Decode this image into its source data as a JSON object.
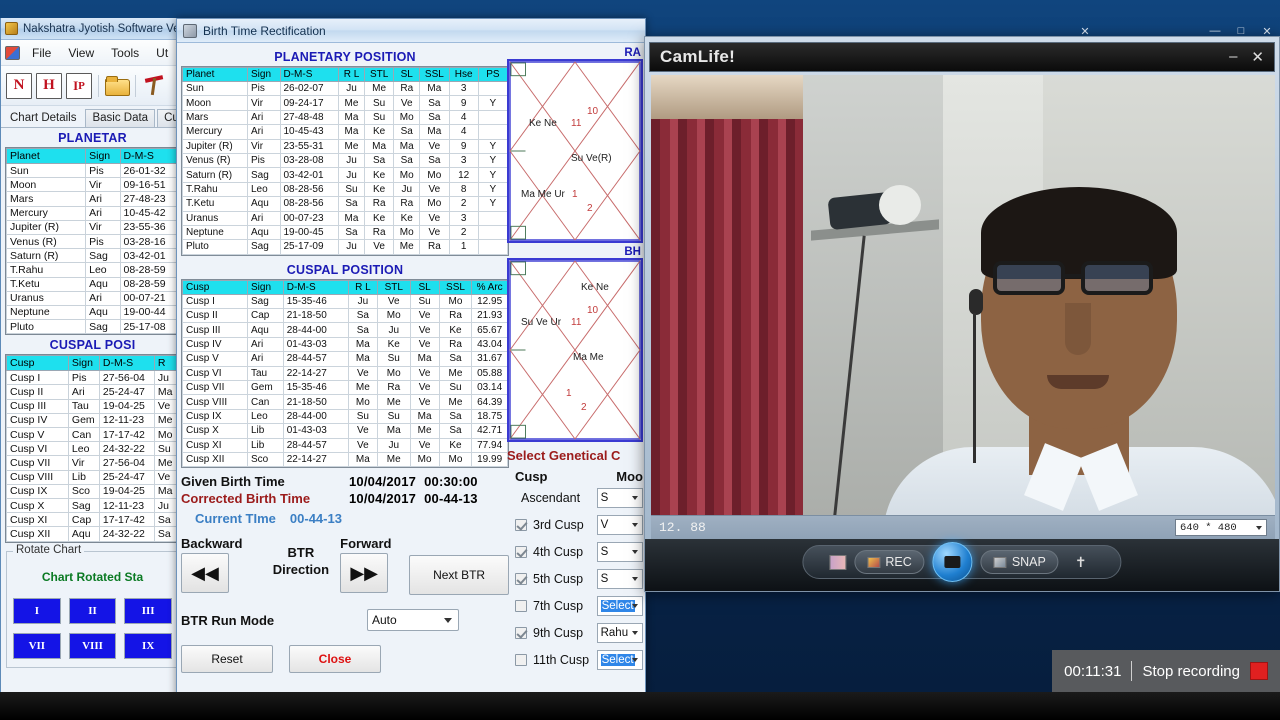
{
  "main_window": {
    "title": "Nakshatra Jyotish Software Ve",
    "menu": [
      "File",
      "View",
      "Tools",
      "Ut"
    ],
    "toolbar_icons": [
      "n-icon",
      "h-icon",
      "lp-icon",
      "open-folder-icon",
      "pin-icon"
    ],
    "tabs": [
      {
        "label": "Chart Details",
        "active": true
      },
      {
        "label": "Basic Data",
        "active": false
      },
      {
        "label": "Cuspal",
        "active": false
      }
    ],
    "planetary_title": "PLANETAR",
    "planetary_headers": [
      "Planet",
      "Sign",
      "D-M-S"
    ],
    "planetary_rows": [
      [
        "Sun",
        "Pis",
        "26-01-32"
      ],
      [
        "Moon",
        "Vir",
        "09-16-51"
      ],
      [
        "Mars",
        "Ari",
        "27-48-23"
      ],
      [
        "Mercury",
        "Ari",
        "10-45-42"
      ],
      [
        "Jupiter (R)",
        "Vir",
        "23-55-36"
      ],
      [
        "Venus (R)",
        "Pis",
        "03-28-16"
      ],
      [
        "Saturn (R)",
        "Sag",
        "03-42-01"
      ],
      [
        "T.Rahu",
        "Leo",
        "08-28-59"
      ],
      [
        "T.Ketu",
        "Aqu",
        "08-28-59"
      ],
      [
        "Uranus",
        "Ari",
        "00-07-21"
      ],
      [
        "Neptune",
        "Aqu",
        "19-00-44"
      ],
      [
        "Pluto",
        "Sag",
        "25-17-08"
      ]
    ],
    "cuspal_title": "CUSPAL POSI",
    "cuspal_headers": [
      "Cusp",
      "Sign",
      "D-M-S",
      "R"
    ],
    "cuspal_rows": [
      [
        "Cusp I",
        "Pis",
        "27-56-04",
        "Ju"
      ],
      [
        "Cusp II",
        "Ari",
        "25-24-47",
        "Ma"
      ],
      [
        "Cusp III",
        "Tau",
        "19-04-25",
        "Ve"
      ],
      [
        "Cusp IV",
        "Gem",
        "12-11-23",
        "Me"
      ],
      [
        "Cusp V",
        "Can",
        "17-17-42",
        "Mo"
      ],
      [
        "Cusp VI",
        "Leo",
        "24-32-22",
        "Su"
      ],
      [
        "Cusp VII",
        "Vir",
        "27-56-04",
        "Me"
      ],
      [
        "Cusp VIII",
        "Lib",
        "25-24-47",
        "Ve"
      ],
      [
        "Cusp IX",
        "Sco",
        "19-04-25",
        "Ma"
      ],
      [
        "Cusp X",
        "Sag",
        "12-11-23",
        "Ju"
      ],
      [
        "Cusp XI",
        "Cap",
        "17-17-42",
        "Sa"
      ],
      [
        "Cusp XII",
        "Aqu",
        "24-32-22",
        "Sa"
      ]
    ],
    "rotate": {
      "legend": "Rotate Chart",
      "status": "Chart Rotated Sta",
      "buttons": [
        "I",
        "II",
        "III",
        "VII",
        "VIII",
        "IX"
      ]
    }
  },
  "btr_dialog": {
    "title": "Birth Time Rectification",
    "planetary_title": "PLANETARY POSITION",
    "planetary_headers": [
      "Planet",
      "Sign",
      "D-M-S",
      "R L",
      "STL",
      "SL",
      "SSL",
      "Hse",
      "PS"
    ],
    "planetary_rows": [
      [
        "Sun",
        "Pis",
        "26-02-07",
        "Ju",
        "Me",
        "Ra",
        "Ma",
        "3",
        ""
      ],
      [
        "Moon",
        "Vir",
        "09-24-17",
        "Me",
        "Su",
        "Ve",
        "Sa",
        "9",
        "Y"
      ],
      [
        "Mars",
        "Ari",
        "27-48-48",
        "Ma",
        "Su",
        "Mo",
        "Sa",
        "4",
        ""
      ],
      [
        "Mercury",
        "Ari",
        "10-45-43",
        "Ma",
        "Ke",
        "Sa",
        "Ma",
        "4",
        ""
      ],
      [
        "Jupiter (R)",
        "Vir",
        "23-55-31",
        "Me",
        "Ma",
        "Ma",
        "Ve",
        "9",
        "Y"
      ],
      [
        "Venus (R)",
        "Pis",
        "03-28-08",
        "Ju",
        "Sa",
        "Sa",
        "Sa",
        "3",
        "Y"
      ],
      [
        "Saturn (R)",
        "Sag",
        "03-42-01",
        "Ju",
        "Ke",
        "Mo",
        "Mo",
        "12",
        "Y"
      ],
      [
        "T.Rahu",
        "Leo",
        "08-28-56",
        "Su",
        "Ke",
        "Ju",
        "Ve",
        "8",
        "Y"
      ],
      [
        "T.Ketu",
        "Aqu",
        "08-28-56",
        "Sa",
        "Ra",
        "Ra",
        "Mo",
        "2",
        "Y"
      ],
      [
        "Uranus",
        "Ari",
        "00-07-23",
        "Ma",
        "Ke",
        "Ke",
        "Ve",
        "3",
        ""
      ],
      [
        "Neptune",
        "Aqu",
        "19-00-45",
        "Sa",
        "Ra",
        "Mo",
        "Ve",
        "2",
        ""
      ],
      [
        "Pluto",
        "Sag",
        "25-17-09",
        "Ju",
        "Ve",
        "Me",
        "Ra",
        "1",
        ""
      ]
    ],
    "cuspal_title": "CUSPAL POSITION",
    "cuspal_headers": [
      "Cusp",
      "Sign",
      "D-M-S",
      "R L",
      "STL",
      "SL",
      "SSL",
      "% Arc"
    ],
    "cuspal_rows": [
      [
        "Cusp I",
        "Sag",
        "15-35-46",
        "Ju",
        "Ve",
        "Su",
        "Mo",
        "12.95"
      ],
      [
        "Cusp II",
        "Cap",
        "21-18-50",
        "Sa",
        "Mo",
        "Ve",
        "Ra",
        "21.93"
      ],
      [
        "Cusp III",
        "Aqu",
        "28-44-00",
        "Sa",
        "Ju",
        "Ve",
        "Ke",
        "65.67"
      ],
      [
        "Cusp IV",
        "Ari",
        "01-43-03",
        "Ma",
        "Ke",
        "Ve",
        "Ra",
        "43.04"
      ],
      [
        "Cusp V",
        "Ari",
        "28-44-57",
        "Ma",
        "Su",
        "Ma",
        "Sa",
        "31.67"
      ],
      [
        "Cusp VI",
        "Tau",
        "22-14-27",
        "Ve",
        "Mo",
        "Ve",
        "Me",
        "05.88"
      ],
      [
        "Cusp VII",
        "Gem",
        "15-35-46",
        "Me",
        "Ra",
        "Ve",
        "Su",
        "03.14"
      ],
      [
        "Cusp VIII",
        "Can",
        "21-18-50",
        "Mo",
        "Me",
        "Ve",
        "Me",
        "64.39"
      ],
      [
        "Cusp IX",
        "Leo",
        "28-44-00",
        "Su",
        "Su",
        "Ma",
        "Sa",
        "18.75"
      ],
      [
        "Cusp X",
        "Lib",
        "01-43-03",
        "Ve",
        "Ma",
        "Me",
        "Sa",
        "42.71"
      ],
      [
        "Cusp XI",
        "Lib",
        "28-44-57",
        "Ve",
        "Ju",
        "Ve",
        "Ke",
        "77.94"
      ],
      [
        "Cusp XII",
        "Sco",
        "22-14-27",
        "Ma",
        "Me",
        "Mo",
        "Mo",
        "19.99"
      ]
    ],
    "times": {
      "given_label": "Given Birth Time",
      "given_date": "10/04/2017",
      "given_time": "00:30:00",
      "corrected_label": "Corrected Birth Time",
      "corrected_date": "10/04/2017",
      "corrected_time": "00-44-13",
      "current_label": "Current TIme",
      "current_time": "00-44-13"
    },
    "controls": {
      "backward_label": "Backward",
      "forward_label": "Forward",
      "backward_icon": "◀◀",
      "forward_icon": "▶▶",
      "btr_direction": "BTR\nDirection",
      "btr_direction_line1": "BTR",
      "btr_direction_line2": "Direction",
      "next_btr": "Next BTR",
      "run_mode_label": "BTR Run Mode",
      "run_mode_value": "Auto",
      "reset": "Reset",
      "close": "Close"
    },
    "genetical": {
      "title": "Select Genetical C",
      "col_cusp": "Cusp",
      "col_mode": "Moo",
      "rows": [
        {
          "label": "Ascendant",
          "checkbox": null,
          "value": "S"
        },
        {
          "label": "3rd Cusp",
          "checkbox": true,
          "value": "V"
        },
        {
          "label": "4th Cusp",
          "checkbox": true,
          "value": "S"
        },
        {
          "label": "5th Cusp",
          "checkbox": true,
          "value": "S"
        },
        {
          "label": "7th Cusp",
          "checkbox": false,
          "value": "Select",
          "highlight": true
        },
        {
          "label": "9th Cusp",
          "checkbox": true,
          "value": "Rahu",
          "highlight": false
        },
        {
          "label": "11th Cusp",
          "checkbox": false,
          "value": "Select",
          "highlight": true
        }
      ]
    },
    "charts": [
      {
        "title": "RA",
        "name": "rasi-chart",
        "labels": [
          "Ke Ne",
          "Su Ve(R)",
          "Ma Me Ur"
        ],
        "numbers": [
          "10",
          "11",
          "1",
          "2"
        ]
      },
      {
        "title": "BH",
        "name": "bhava-chart",
        "labels": [
          "Ke Ne",
          "Su Ve Ur",
          "Ma Me"
        ],
        "numbers": [
          "10",
          "11",
          "1",
          "2"
        ]
      }
    ]
  },
  "camlife": {
    "title": "CamLife!",
    "minimize": "–",
    "close": "✕",
    "status_value": "12. 88",
    "resolution": "640 * 480",
    "dock": {
      "gallery_icon": "film-strip-icon",
      "rec_label": "REC",
      "snap_label": "SNAP",
      "shutter_icon": "camera-icon",
      "effects_icon": "person-icon"
    }
  },
  "recorder": {
    "elapsed": "00:11:31",
    "action": "Stop recording",
    "stop_icon": "stop-square-icon"
  },
  "outer_window_buttons": {
    "close_small": "✕",
    "minimize": "—",
    "maximize": "□",
    "close": "✕"
  }
}
